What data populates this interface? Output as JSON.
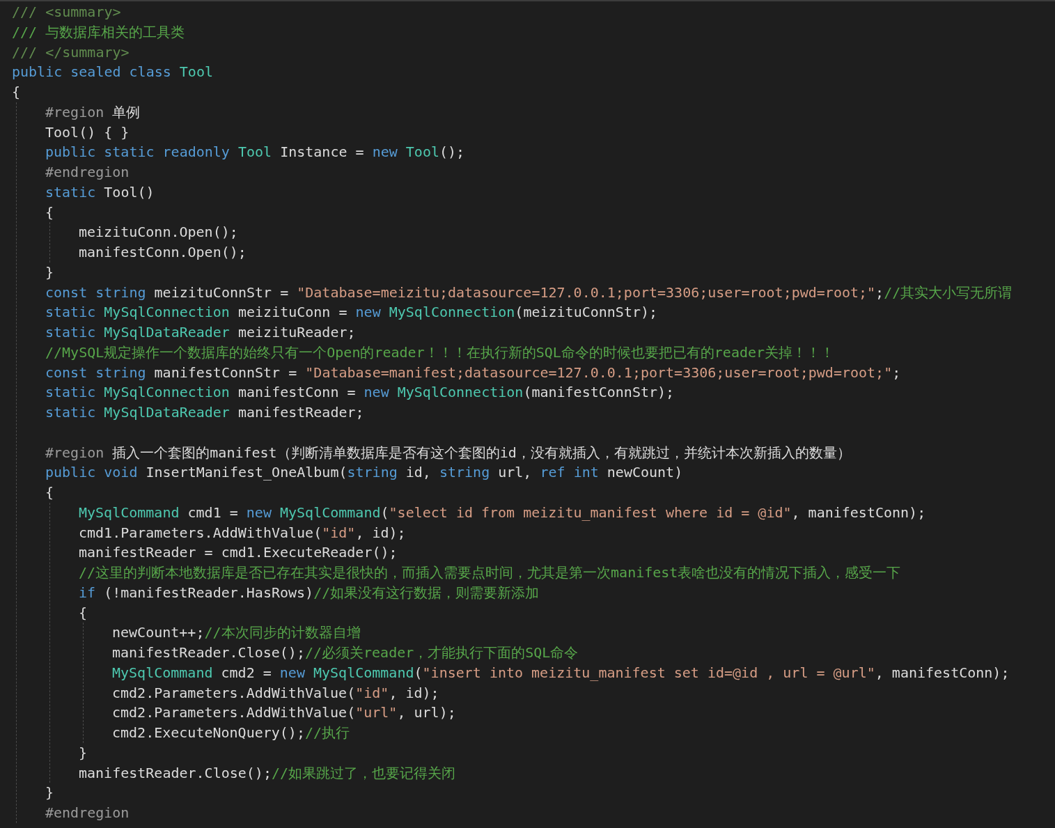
{
  "code": [
    {
      "kind": "line",
      "tokens": [
        {
          "kind": "doc",
          "text": "/// <summary>"
        }
      ]
    },
    {
      "kind": "line",
      "tokens": [
        {
          "kind": "comment",
          "text": "/// 与数据库相关的工具类"
        }
      ]
    },
    {
      "kind": "line",
      "tokens": [
        {
          "kind": "doc",
          "text": "/// </summary>"
        }
      ]
    },
    {
      "kind": "line",
      "tokens": [
        {
          "kind": "keyword",
          "text": "public sealed class "
        },
        {
          "kind": "type",
          "text": "Tool"
        }
      ]
    },
    {
      "kind": "line",
      "tokens": [
        {
          "kind": "plain",
          "text": "{"
        }
      ]
    },
    {
      "kind": "block",
      "children": [
        {
          "kind": "line",
          "tokens": [
            {
              "kind": "directive",
              "text": "#region "
            },
            {
              "kind": "plain",
              "text": "单例"
            }
          ]
        },
        {
          "kind": "line",
          "tokens": [
            {
              "kind": "plain",
              "text": "Tool() { }"
            }
          ]
        },
        {
          "kind": "line",
          "tokens": [
            {
              "kind": "keyword",
              "text": "public static readonly "
            },
            {
              "kind": "type",
              "text": "Tool"
            },
            {
              "kind": "plain",
              "text": " Instance = "
            },
            {
              "kind": "keyword",
              "text": "new "
            },
            {
              "kind": "type",
              "text": "Tool"
            },
            {
              "kind": "plain",
              "text": "();"
            }
          ]
        },
        {
          "kind": "line",
          "tokens": [
            {
              "kind": "directive",
              "text": "#endregion"
            }
          ]
        },
        {
          "kind": "line",
          "tokens": [
            {
              "kind": "keyword",
              "text": "static "
            },
            {
              "kind": "plain",
              "text": "Tool()"
            }
          ]
        },
        {
          "kind": "line",
          "tokens": [
            {
              "kind": "plain",
              "text": "{"
            }
          ]
        },
        {
          "kind": "block",
          "children": [
            {
              "kind": "line",
              "tokens": [
                {
                  "kind": "plain",
                  "text": "meizituConn.Open();"
                }
              ]
            },
            {
              "kind": "line",
              "tokens": [
                {
                  "kind": "plain",
                  "text": "manifestConn.Open();"
                }
              ]
            }
          ]
        },
        {
          "kind": "line",
          "tokens": [
            {
              "kind": "plain",
              "text": "}"
            }
          ]
        },
        {
          "kind": "line",
          "tokens": [
            {
              "kind": "keyword",
              "text": "const string "
            },
            {
              "kind": "plain",
              "text": "meizituConnStr = "
            },
            {
              "kind": "string",
              "text": "\"Database=meizitu;datasource=127.0.0.1;port=3306;user=root;pwd=root;\""
            },
            {
              "kind": "plain",
              "text": ";"
            },
            {
              "kind": "comment",
              "text": "//其实大小写无所谓"
            }
          ]
        },
        {
          "kind": "line",
          "tokens": [
            {
              "kind": "keyword",
              "text": "static "
            },
            {
              "kind": "type",
              "text": "MySqlConnection"
            },
            {
              "kind": "plain",
              "text": " meizituConn = "
            },
            {
              "kind": "keyword",
              "text": "new "
            },
            {
              "kind": "type",
              "text": "MySqlConnection"
            },
            {
              "kind": "plain",
              "text": "(meizituConnStr);"
            }
          ]
        },
        {
          "kind": "line",
          "tokens": [
            {
              "kind": "keyword",
              "text": "static "
            },
            {
              "kind": "type",
              "text": "MySqlDataReader"
            },
            {
              "kind": "plain",
              "text": " meizituReader;"
            }
          ]
        },
        {
          "kind": "line",
          "tokens": [
            {
              "kind": "comment",
              "text": "//MySQL规定操作一个数据库的始终只有一个Open的reader！！！在执行新的SQL命令的时候也要把已有的reader关掉！！！"
            }
          ]
        },
        {
          "kind": "line",
          "tokens": [
            {
              "kind": "keyword",
              "text": "const string "
            },
            {
              "kind": "plain",
              "text": "manifestConnStr = "
            },
            {
              "kind": "string",
              "text": "\"Database=manifest;datasource=127.0.0.1;port=3306;user=root;pwd=root;\""
            },
            {
              "kind": "plain",
              "text": ";"
            }
          ]
        },
        {
          "kind": "line",
          "tokens": [
            {
              "kind": "keyword",
              "text": "static "
            },
            {
              "kind": "type",
              "text": "MySqlConnection"
            },
            {
              "kind": "plain",
              "text": " manifestConn = "
            },
            {
              "kind": "keyword",
              "text": "new "
            },
            {
              "kind": "type",
              "text": "MySqlConnection"
            },
            {
              "kind": "plain",
              "text": "(manifestConnStr);"
            }
          ]
        },
        {
          "kind": "line",
          "tokens": [
            {
              "kind": "keyword",
              "text": "static "
            },
            {
              "kind": "type",
              "text": "MySqlDataReader"
            },
            {
              "kind": "plain",
              "text": " manifestReader;"
            }
          ]
        },
        {
          "kind": "blank"
        },
        {
          "kind": "line",
          "tokens": [
            {
              "kind": "directive",
              "text": "#region "
            },
            {
              "kind": "plain",
              "text": "插入一个套图的manifest（判断清单数据库是否有这个套图的id，没有就插入，有就跳过，并统计本次新插入的数量）"
            }
          ]
        },
        {
          "kind": "line",
          "tokens": [
            {
              "kind": "keyword",
              "text": "public void "
            },
            {
              "kind": "plain",
              "text": "InsertManifest_OneAlbum("
            },
            {
              "kind": "keyword",
              "text": "string "
            },
            {
              "kind": "plain",
              "text": "id, "
            },
            {
              "kind": "keyword",
              "text": "string "
            },
            {
              "kind": "plain",
              "text": "url, "
            },
            {
              "kind": "keyword",
              "text": "ref int "
            },
            {
              "kind": "plain",
              "text": "newCount)"
            }
          ]
        },
        {
          "kind": "line",
          "tokens": [
            {
              "kind": "plain",
              "text": "{"
            }
          ]
        },
        {
          "kind": "block",
          "children": [
            {
              "kind": "line",
              "tokens": [
                {
                  "kind": "type",
                  "text": "MySqlCommand"
                },
                {
                  "kind": "plain",
                  "text": " cmd1 = "
                },
                {
                  "kind": "keyword",
                  "text": "new "
                },
                {
                  "kind": "type",
                  "text": "MySqlCommand"
                },
                {
                  "kind": "plain",
                  "text": "("
                },
                {
                  "kind": "string",
                  "text": "\"select id from meizitu_manifest where id = @id\""
                },
                {
                  "kind": "plain",
                  "text": ", manifestConn);"
                }
              ]
            },
            {
              "kind": "line",
              "tokens": [
                {
                  "kind": "plain",
                  "text": "cmd1.Parameters.AddWithValue("
                },
                {
                  "kind": "string",
                  "text": "\"id\""
                },
                {
                  "kind": "plain",
                  "text": ", id);"
                }
              ]
            },
            {
              "kind": "line",
              "tokens": [
                {
                  "kind": "plain",
                  "text": "manifestReader = cmd1.ExecuteReader();"
                }
              ]
            },
            {
              "kind": "line",
              "tokens": [
                {
                  "kind": "comment",
                  "text": "//这里的判断本地数据库是否已存在其实是很快的，而插入需要点时间，尤其是第一次manifest表啥也没有的情况下插入，感受一下"
                }
              ]
            },
            {
              "kind": "line",
              "tokens": [
                {
                  "kind": "keyword",
                  "text": "if "
                },
                {
                  "kind": "plain",
                  "text": "(!manifestReader.HasRows)"
                },
                {
                  "kind": "comment",
                  "text": "//如果没有这行数据，则需要新添加"
                }
              ]
            },
            {
              "kind": "line",
              "tokens": [
                {
                  "kind": "plain",
                  "text": "{"
                }
              ]
            },
            {
              "kind": "block",
              "children": [
                {
                  "kind": "line",
                  "tokens": [
                    {
                      "kind": "plain",
                      "text": "newCount++;"
                    },
                    {
                      "kind": "comment",
                      "text": "//本次同步的计数器自增"
                    }
                  ]
                },
                {
                  "kind": "line",
                  "tokens": [
                    {
                      "kind": "plain",
                      "text": "manifestReader.Close();"
                    },
                    {
                      "kind": "comment",
                      "text": "//必须关reader，才能执行下面的SQL命令"
                    }
                  ]
                },
                {
                  "kind": "line",
                  "tokens": [
                    {
                      "kind": "type",
                      "text": "MySqlCommand"
                    },
                    {
                      "kind": "plain",
                      "text": " cmd2 = "
                    },
                    {
                      "kind": "keyword",
                      "text": "new "
                    },
                    {
                      "kind": "type",
                      "text": "MySqlCommand"
                    },
                    {
                      "kind": "plain",
                      "text": "("
                    },
                    {
                      "kind": "string",
                      "text": "\"insert into meizitu_manifest set id=@id , url = @url\""
                    },
                    {
                      "kind": "plain",
                      "text": ", manifestConn);"
                    }
                  ]
                },
                {
                  "kind": "line",
                  "tokens": [
                    {
                      "kind": "plain",
                      "text": "cmd2.Parameters.AddWithValue("
                    },
                    {
                      "kind": "string",
                      "text": "\"id\""
                    },
                    {
                      "kind": "plain",
                      "text": ", id);"
                    }
                  ]
                },
                {
                  "kind": "line",
                  "tokens": [
                    {
                      "kind": "plain",
                      "text": "cmd2.Parameters.AddWithValue("
                    },
                    {
                      "kind": "string",
                      "text": "\"url\""
                    },
                    {
                      "kind": "plain",
                      "text": ", url);"
                    }
                  ]
                },
                {
                  "kind": "line",
                  "tokens": [
                    {
                      "kind": "plain",
                      "text": "cmd2.ExecuteNonQuery();"
                    },
                    {
                      "kind": "comment",
                      "text": "//执行"
                    }
                  ]
                }
              ]
            },
            {
              "kind": "line",
              "tokens": [
                {
                  "kind": "plain",
                  "text": "}"
                }
              ]
            },
            {
              "kind": "line",
              "tokens": [
                {
                  "kind": "plain",
                  "text": "manifestReader.Close();"
                },
                {
                  "kind": "comment",
                  "text": "//如果跳过了，也要记得关闭"
                }
              ]
            }
          ]
        },
        {
          "kind": "line",
          "tokens": [
            {
              "kind": "plain",
              "text": "}"
            }
          ]
        },
        {
          "kind": "line",
          "tokens": [
            {
              "kind": "directive",
              "text": "#endregion"
            }
          ]
        }
      ]
    }
  ]
}
